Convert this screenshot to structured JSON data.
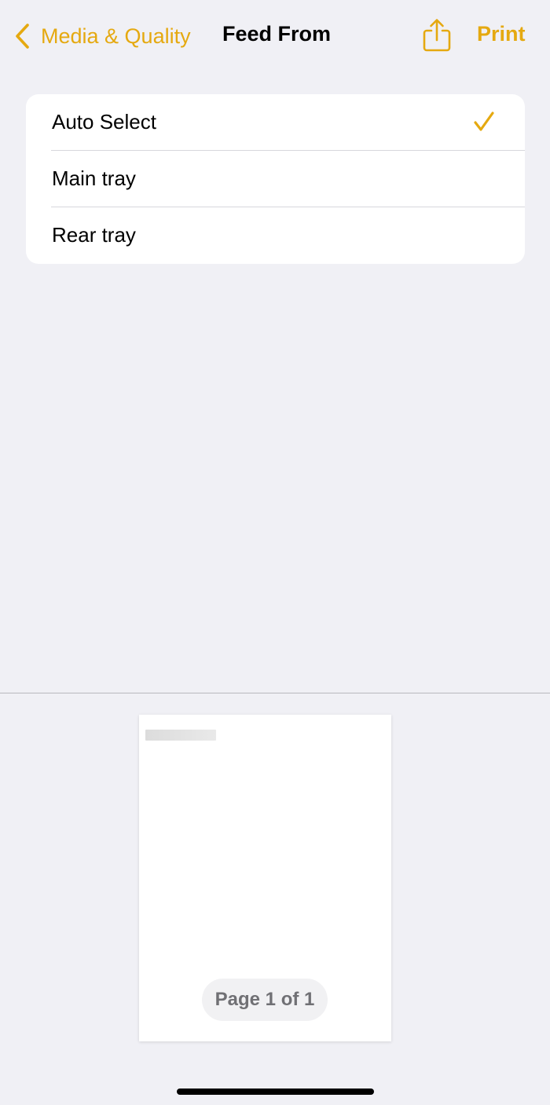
{
  "nav": {
    "back_label": "Media & Quality",
    "title": "Feed From",
    "print_label": "Print",
    "back_icon": "chevron-left-icon",
    "share_icon": "share-icon"
  },
  "options": {
    "items": [
      {
        "label": "Auto Select",
        "selected": true
      },
      {
        "label": "Main tray",
        "selected": false
      },
      {
        "label": "Rear tray",
        "selected": false
      }
    ],
    "selected_icon": "checkmark-icon"
  },
  "preview": {
    "page_indicator": "Page 1 of 1"
  },
  "colors": {
    "accent": "#e5a910",
    "background": "#f0f0f5",
    "card": "#ffffff",
    "divider": "#d7d7dc"
  }
}
